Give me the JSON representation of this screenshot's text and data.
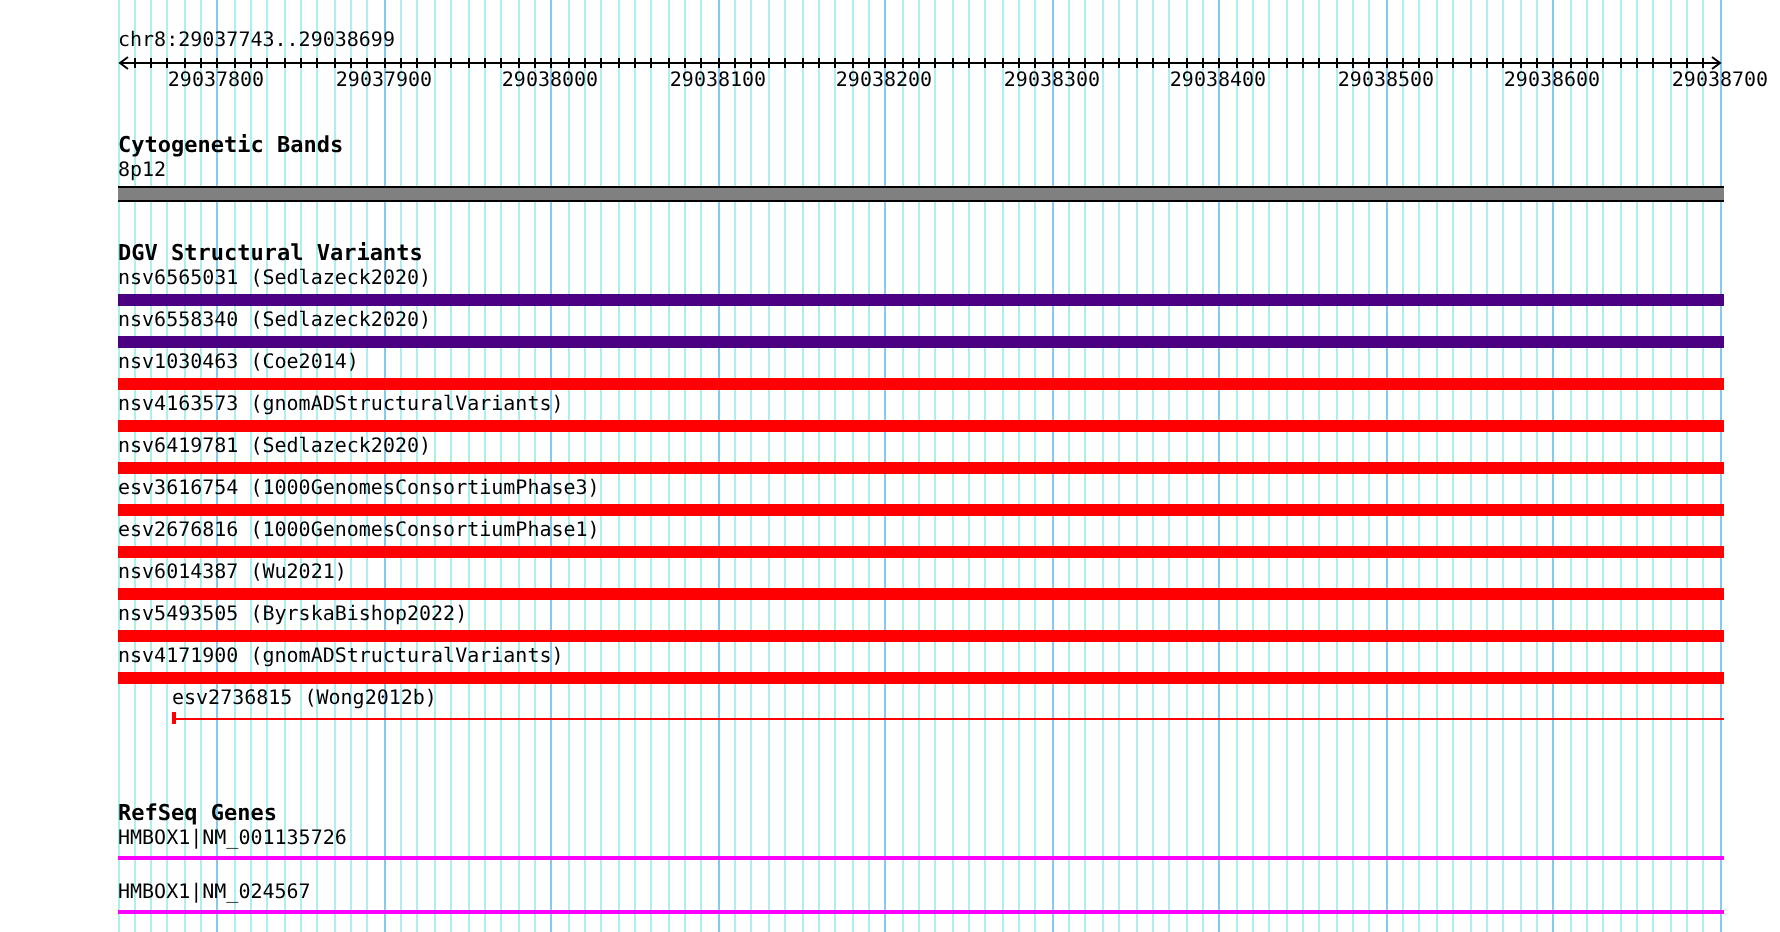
{
  "location": "chr8:29037743..29038699",
  "ruler": {
    "ticks": [
      "29037800",
      "29037900",
      "29038000",
      "29038100",
      "29038200",
      "29038300",
      "29038400",
      "29038500",
      "29038600",
      "29038700"
    ]
  },
  "tracks": [
    {
      "title": "Cytogenetic Bands",
      "kind": "bands",
      "features": [
        {
          "label": "8p12",
          "kind": "band",
          "color": "#808080"
        }
      ]
    },
    {
      "title": "DGV Structural Variants",
      "kind": "variants",
      "features": [
        {
          "label": "nsv6565031 (Sedlazeck2020)",
          "kind": "bar",
          "color": "#4b0082"
        },
        {
          "label": "nsv6558340 (Sedlazeck2020)",
          "kind": "bar",
          "color": "#4b0082"
        },
        {
          "label": "nsv1030463 (Coe2014)",
          "kind": "bar",
          "color": "#ff0000"
        },
        {
          "label": "nsv4163573 (gnomADStructuralVariants)",
          "kind": "bar",
          "color": "#ff0000"
        },
        {
          "label": "nsv6419781 (Sedlazeck2020)",
          "kind": "bar",
          "color": "#ff0000"
        },
        {
          "label": "esv3616754 (1000GenomesConsortiumPhase3)",
          "kind": "bar",
          "color": "#ff0000"
        },
        {
          "label": "esv2676816 (1000GenomesConsortiumPhase1)",
          "kind": "bar",
          "color": "#ff0000"
        },
        {
          "label": "nsv6014387 (Wu2021)",
          "kind": "bar",
          "color": "#ff0000"
        },
        {
          "label": "nsv5493505 (ByrskaBishop2022)",
          "kind": "bar",
          "color": "#ff0000"
        },
        {
          "label": "nsv4171900 (gnomADStructuralVariants)",
          "kind": "bar",
          "color": "#ff0000"
        },
        {
          "label": "esv2736815 (Wong2012b)",
          "kind": "span",
          "color": "#ff0000"
        }
      ]
    },
    {
      "title": "RefSeq Genes",
      "kind": "genes",
      "features": [
        {
          "label": "HMBOX1|NM_001135726",
          "kind": "gene",
          "color": "#ff00ff"
        },
        {
          "label": "HMBOX1|NM_024567",
          "kind": "gene",
          "color": "#ff00ff"
        }
      ]
    }
  ]
}
